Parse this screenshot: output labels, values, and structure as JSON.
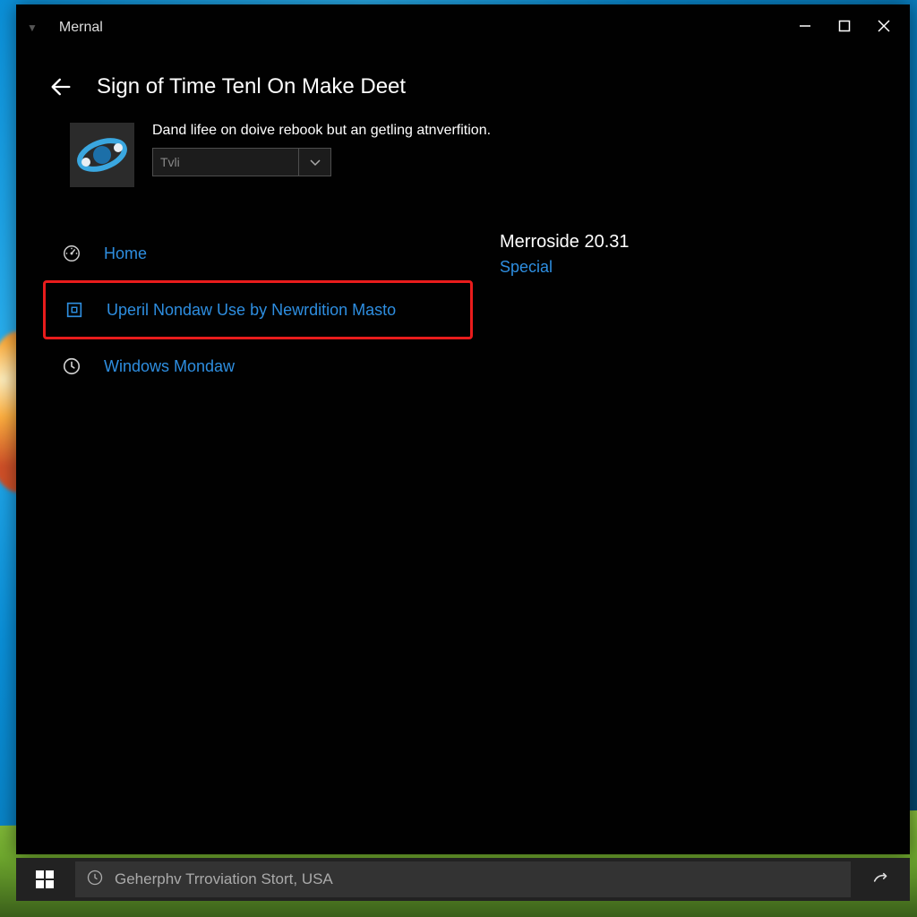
{
  "titlebar": {
    "app_name": "Mernal"
  },
  "header": {
    "page_title": "Sign of Time Tenl On Make Deet"
  },
  "info": {
    "description": "Dand lifee on doive rebook but an getling atnverfition.",
    "dropdown_value": "Tvli"
  },
  "nav": {
    "items": [
      {
        "label": "Home",
        "icon": "gauge-icon",
        "highlighted": false
      },
      {
        "label": "Uperil Nondaw Use by Newrdition Masto",
        "icon": "square-icon",
        "highlighted": true
      },
      {
        "label": "Windows Mondaw",
        "icon": "clock-icon",
        "highlighted": false
      }
    ]
  },
  "sidebar": {
    "line1": "Merroside 20.31",
    "line2": "Special"
  },
  "taskbar": {
    "search_placeholder": "Geherphv Trroviation Stort, USA"
  },
  "colors": {
    "accent_link": "#2e8ee0",
    "highlight_border": "#e91c1c"
  }
}
